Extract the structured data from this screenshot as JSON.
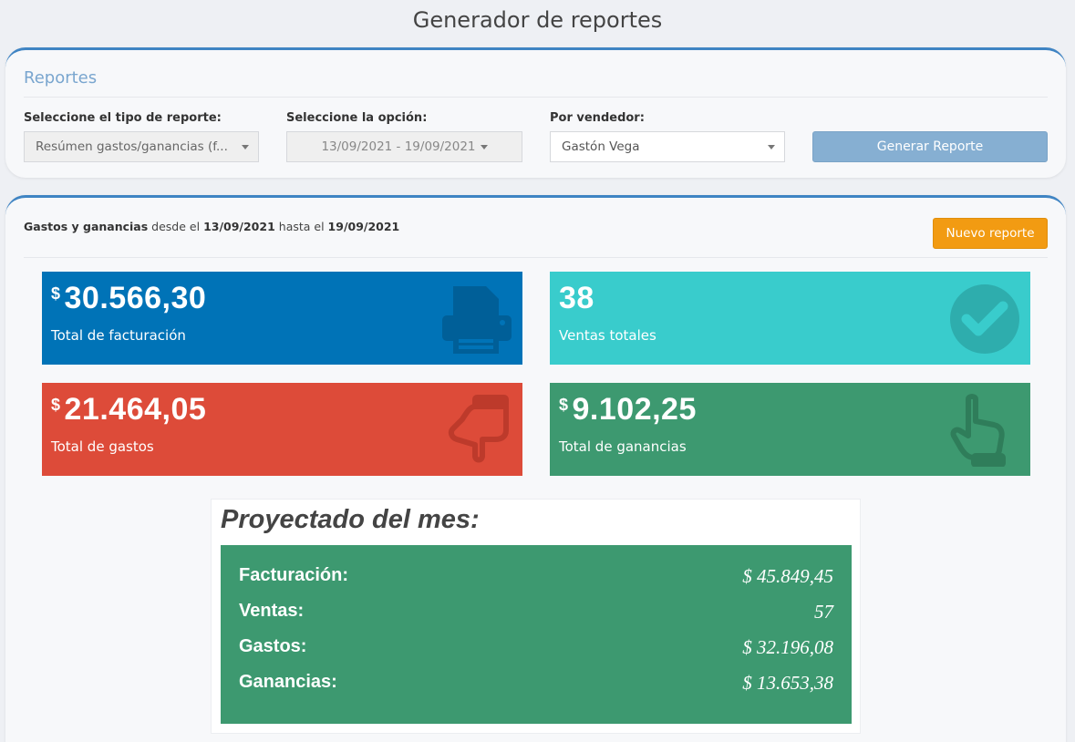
{
  "header": {
    "title": "Generador de reportes"
  },
  "filters": {
    "heading": "Reportes",
    "type_label": "Seleccione el tipo de reporte:",
    "type_value": "Resúmen gastos/ganancias (f...",
    "option_label": "Seleccione la opción:",
    "option_value": "13/09/2021 - 19/09/2021",
    "seller_label": "Por vendedor:",
    "seller_value": "Gastón Vega",
    "generate_label": "Generar Reporte"
  },
  "results": {
    "summary_bold": "Gastos y ganancias",
    "summary_from": "desde el",
    "date_from": "13/09/2021",
    "summary_to": "hasta el",
    "date_to": "19/09/2021",
    "new_report_label": "Nuevo reporte"
  },
  "stats": {
    "billing": {
      "currency": "$",
      "value": "30.566,30",
      "label": "Total de facturación",
      "icon": "printer-icon",
      "color": "#0073b7"
    },
    "sales": {
      "value": "38",
      "label": "Ventas totales",
      "icon": "check-circle-icon",
      "color": "#39cccc"
    },
    "expenses": {
      "currency": "$",
      "value": "21.464,05",
      "label": "Total de gastos",
      "icon": "thumbs-down-hand-icon",
      "color": "#dd4b39"
    },
    "profits": {
      "currency": "$",
      "value": "9.102,25",
      "label": "Total de ganancias",
      "icon": "pointing-hand-icon",
      "color": "#3d9970"
    }
  },
  "projected": {
    "title": "Proyectado del mes:",
    "rows": [
      {
        "key": "Facturación:",
        "value": "$ 45.849,45"
      },
      {
        "key": "Ventas:",
        "value": "57"
      },
      {
        "key": "Gastos:",
        "value": "$ 32.196,08"
      },
      {
        "key": "Ganancias:",
        "value": "$ 13.653,38"
      }
    ]
  }
}
